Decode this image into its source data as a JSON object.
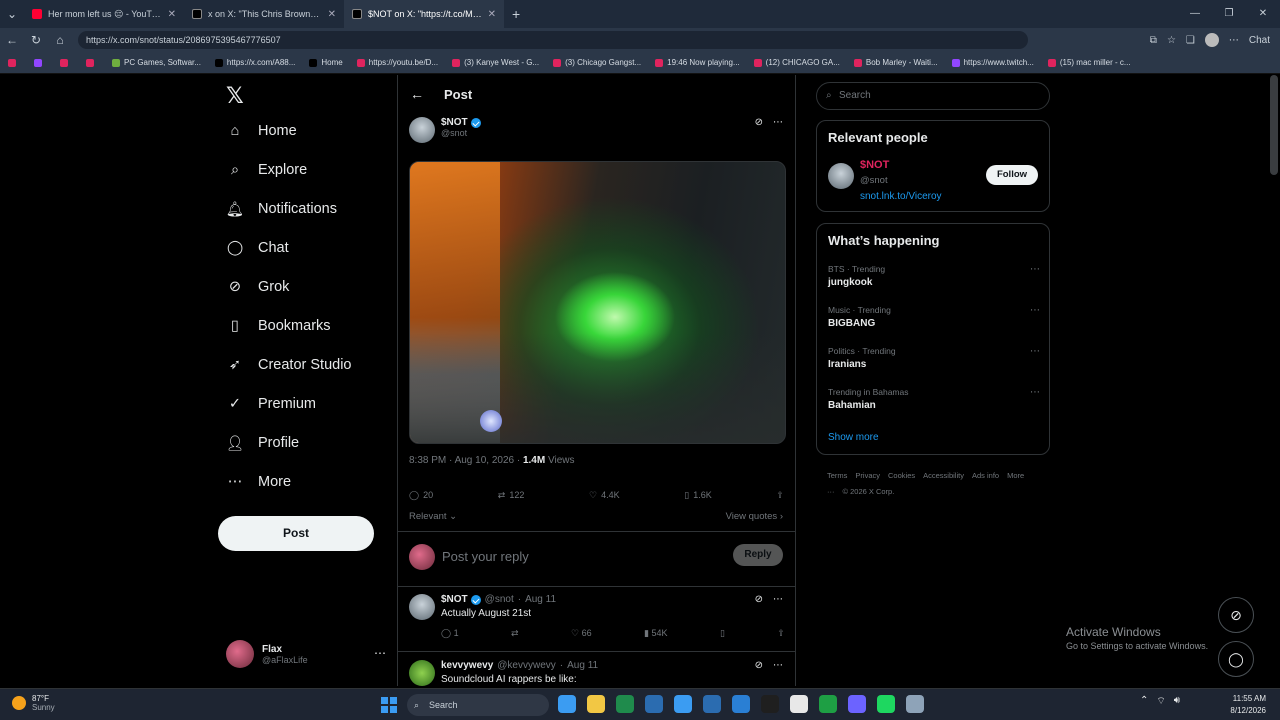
{
  "browser": {
    "tabs": [
      {
        "title": "Her mom left us 😔 - YouTube",
        "active": false,
        "favicon_color": "#ff0033"
      },
      {
        "title": "x on X: \"This Chris Brown and Ush",
        "active": false,
        "favicon_color": "#000000"
      },
      {
        "title": "$NOT on X: \"https://t.co/MO...",
        "active": true,
        "favicon_color": "#000000"
      }
    ],
    "url": "https://x.com/snot/status/2086975395467776507",
    "account_label": "Chat",
    "bookmarks": [
      {
        "label": "",
        "color": "#e0245e"
      },
      {
        "label": "",
        "color": "#9146ff"
      },
      {
        "label": "",
        "color": "#e0245e"
      },
      {
        "label": "",
        "color": "#e0245e"
      },
      {
        "label": "PC Games, Softwar...",
        "color": "#6fae3f"
      },
      {
        "label": "https://x.com/A88...",
        "color": "#000000"
      },
      {
        "label": "Home",
        "color": "#000000"
      },
      {
        "label": "https://youtu.be/D...",
        "color": "#e0245e"
      },
      {
        "label": "(3) Kanye West - G...",
        "color": "#e0245e"
      },
      {
        "label": "(3) Chicago Gangst...",
        "color": "#e0245e"
      },
      {
        "label": "19:46 Now playing...",
        "color": "#e0245e"
      },
      {
        "label": "(12) CHICAGO GA...",
        "color": "#e0245e"
      },
      {
        "label": "Bob Marley - Waiti...",
        "color": "#e0245e"
      },
      {
        "label": "https://www.twitch...",
        "color": "#9146ff"
      },
      {
        "label": "(15) mac miller - c...",
        "color": "#e0245e"
      }
    ]
  },
  "nav": {
    "items": [
      {
        "label": "Home",
        "icon": "home-icon",
        "glyph": "⌂"
      },
      {
        "label": "Explore",
        "icon": "search-icon",
        "glyph": "⌕"
      },
      {
        "label": "Notifications",
        "icon": "bell-icon",
        "glyph": "🔔︎"
      },
      {
        "label": "Chat",
        "icon": "chat-bubble-icon",
        "glyph": "◯"
      },
      {
        "label": "Grok",
        "icon": "grok-icon",
        "glyph": "⊘"
      },
      {
        "label": "Bookmarks",
        "icon": "bookmark-icon",
        "glyph": "▯"
      },
      {
        "label": "Creator Studio",
        "icon": "rocket-icon",
        "glyph": "➶"
      },
      {
        "label": "Premium",
        "icon": "verified-badge-icon",
        "glyph": "✓"
      },
      {
        "label": "Profile",
        "icon": "person-icon",
        "glyph": "👤︎"
      },
      {
        "label": "More",
        "icon": "more-circle-icon",
        "glyph": "⋯"
      }
    ],
    "post_button": "Post",
    "account": {
      "name": "Flax",
      "handle": "@aFlaxLife"
    }
  },
  "main": {
    "header_title": "Post",
    "post": {
      "author_name": "$NOT",
      "author_handle": "@snot",
      "timestamp": "8:38 PM · Aug 10, 2026 ·",
      "views_count": "1.4M",
      "views_label": "Views",
      "replies": "20",
      "reposts": "122",
      "likes": "4.4K",
      "bookmarks": "1.6K"
    },
    "sort_label": "Relevant",
    "view_quotes": "View quotes",
    "reply_placeholder": "Post your reply",
    "reply_button": "Reply",
    "comments": [
      {
        "name": "$NOT",
        "handle": "@snot",
        "date": "Aug 11",
        "text": "Actually August 21st",
        "replies": "1",
        "reposts": "",
        "likes": "66",
        "views": "54K"
      },
      {
        "name": "kevvywevy",
        "handle": "@kevvywevy",
        "date": "Aug 11",
        "text": "Soundcloud AI rappers be like:"
      }
    ]
  },
  "right": {
    "search_placeholder": "Search",
    "relevant_title": "Relevant people",
    "relevant_person": {
      "name": "$NOT",
      "handle": "@snot",
      "link": "snot.lnk.to/Viceroy",
      "follow": "Follow"
    },
    "happening_title": "What’s happening",
    "trends": [
      {
        "category": "BTS · Trending",
        "name": "jungkook"
      },
      {
        "category": "Music · Trending",
        "name": "BIGBANG"
      },
      {
        "category": "Politics · Trending",
        "name": "Iranians"
      },
      {
        "category": "Trending in Bahamas",
        "name": "Bahamian"
      }
    ],
    "show_more": "Show more",
    "footer": [
      "Terms",
      "Privacy",
      "Cookies",
      "Accessibility",
      "Ads info",
      "More ···",
      "© 2026 X Corp."
    ]
  },
  "overlay": {
    "activate_title": "Activate Windows",
    "activate_sub": "Go to Settings to activate Windows."
  },
  "taskbar": {
    "temp": "87°F",
    "condition": "Sunny",
    "search": "Search",
    "time": "11:55 AM",
    "date": "8/12/2026",
    "apps": [
      "#3b9cf2",
      "#f2c744",
      "#1f8b4c",
      "#2b6cb0",
      "#3b9cf2",
      "#2b6cb0",
      "#2a7fd4",
      "#1f1f1f",
      "#e8e8e8",
      "#1e9f44",
      "#6c63ff",
      "#1ed760",
      "#8ea3b8"
    ]
  },
  "colors": {
    "accent": "#1d9bf0",
    "background": "#000000",
    "border": "#2f3336",
    "muted": "#71767b"
  }
}
